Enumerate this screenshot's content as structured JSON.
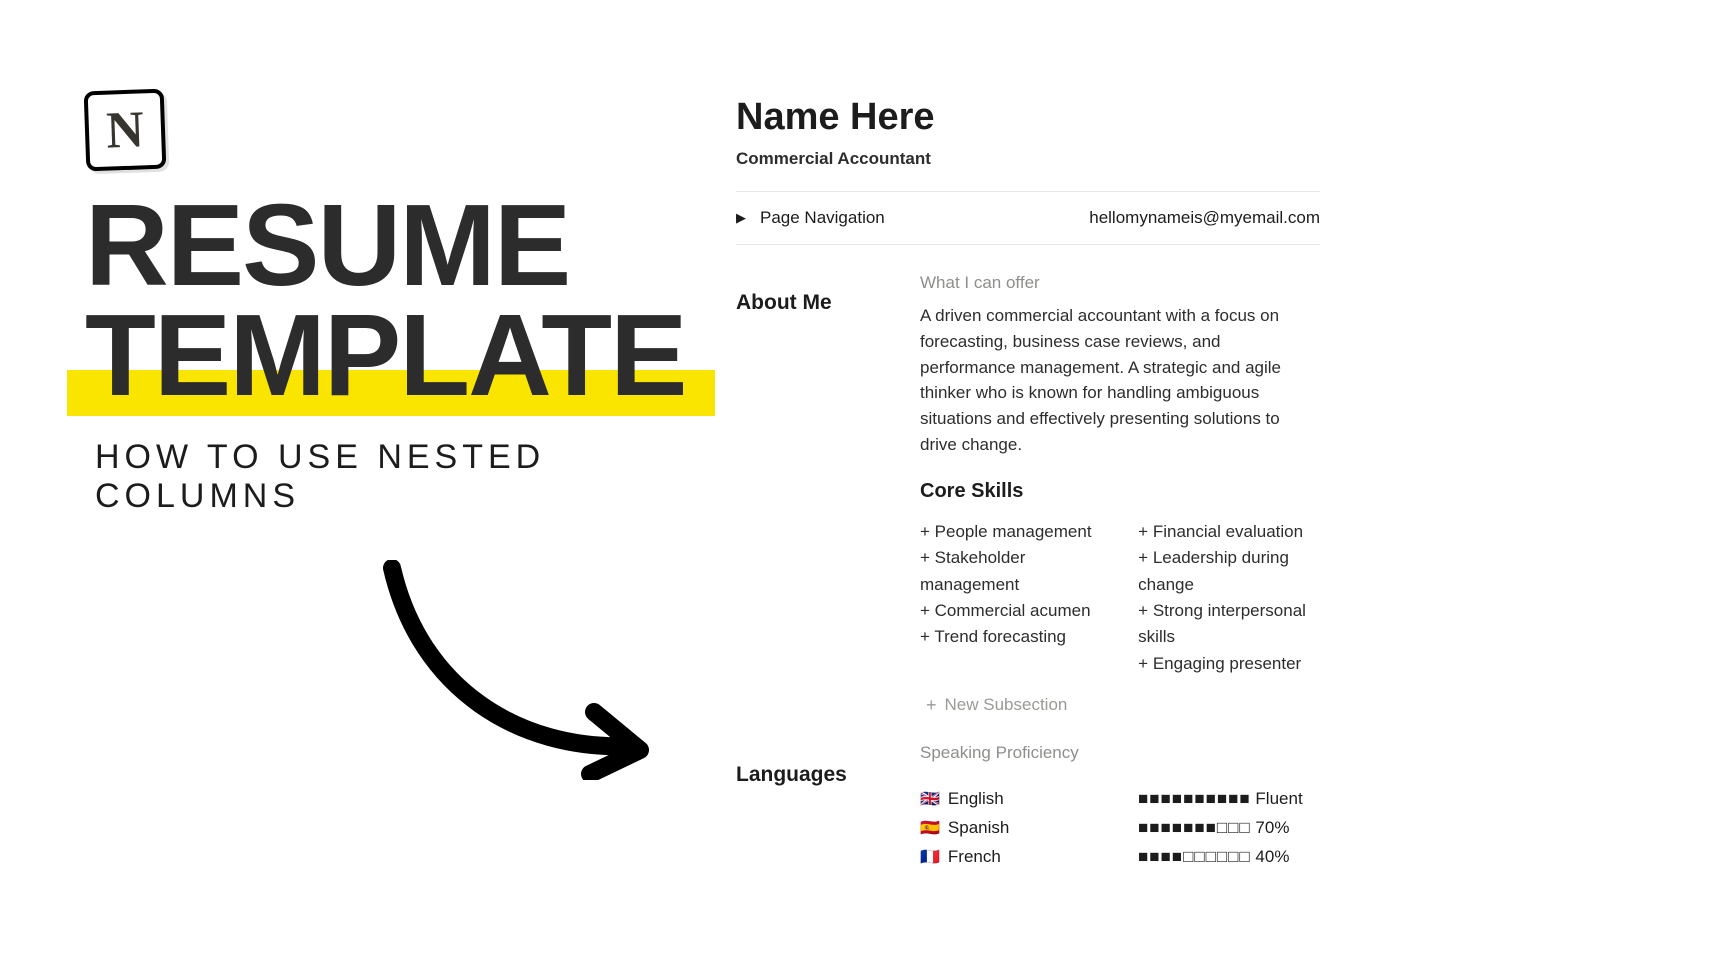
{
  "promo": {
    "logo_letter": "N",
    "title_line1": "RESUME",
    "title_line2": "TEMPLATE",
    "subtitle": "HOW TO USE NESTED COLUMNS"
  },
  "page": {
    "title": "Name Here",
    "subtitle": "Commercial Accountant",
    "nav_toggle_label": "Page Navigation",
    "email": "hellomynameis@myemail.com",
    "about": {
      "section_label": "About Me",
      "offer_caption": "What I can offer",
      "paragraph": "A driven commercial accountant with a focus on forecasting, business case reviews, and performance management. A strategic and agile thinker who is known for handling ambiguous situations and effectively presenting solutions to drive change.",
      "core_skills_heading": "Core Skills",
      "skills_left": [
        "People management",
        "Stakeholder management",
        "Commercial acumen",
        "Trend forecasting"
      ],
      "skills_right": [
        "Financial evaluation",
        "Leadership during change",
        "Strong interpersonal skills",
        "Engaging presenter"
      ],
      "new_subsection_label": "New Subsection"
    },
    "languages": {
      "section_label": "Languages",
      "caption": "Speaking Proficiency",
      "items": [
        {
          "flag": "🇬🇧",
          "name": "English",
          "bar": "■■■■■■■■■■",
          "value": "Fluent"
        },
        {
          "flag": "🇪🇸",
          "name": "Spanish",
          "bar": "■■■■■■■□□□",
          "value": "70%"
        },
        {
          "flag": "🇫🇷",
          "name": "French",
          "bar": "■■■■□□□□□□",
          "value": "40%"
        }
      ]
    }
  }
}
